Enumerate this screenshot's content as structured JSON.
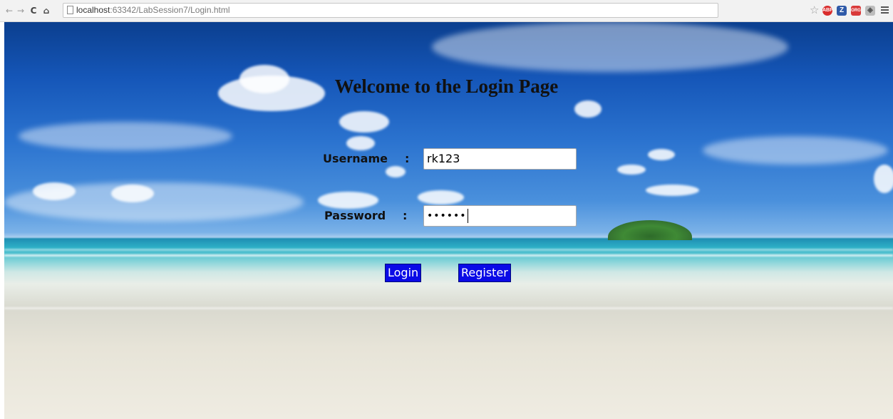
{
  "browser": {
    "url_host": "localhost",
    "url_path": ":63342/LabSession7/Login.html"
  },
  "page": {
    "title": "Welcome to the Login Page",
    "username_label": "Username",
    "password_label": "Password",
    "colon": ":",
    "username_value": "rk123",
    "password_value": "••••••",
    "login_label": "Login",
    "register_label": "Register"
  },
  "colors": {
    "button_bg": "#0a0ae6",
    "button_text": "#ffffff"
  },
  "icons": [
    "back-arrow-icon",
    "forward-arrow-icon",
    "reload-icon",
    "home-icon",
    "page-icon",
    "bookmark-star-icon",
    "adblock-icon",
    "zotero-icon",
    "extension-icon",
    "puzzle-icon",
    "menu-icon"
  ]
}
